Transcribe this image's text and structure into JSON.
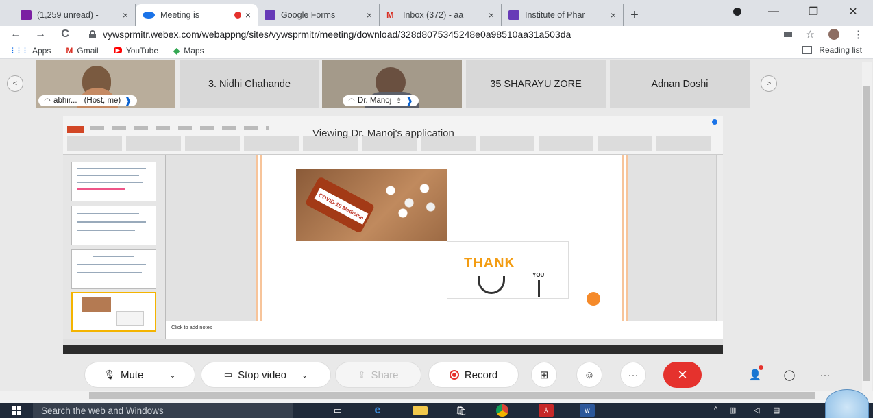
{
  "tabs": [
    {
      "label": "(1,259 unread) -",
      "fav_color": "#7b1fa2",
      "active": false
    },
    {
      "label": "Meeting is",
      "fav_color": "#1a73e8",
      "active": true,
      "recording": true
    },
    {
      "label": "Google Forms",
      "fav_color": "#673ab7",
      "active": false
    },
    {
      "label": "Inbox (372) - aa",
      "fav_color": "#d93025",
      "active": false
    },
    {
      "label": "Institute of Phar",
      "fav_color": "#673ab7",
      "active": false
    }
  ],
  "tab_close": "×",
  "new_tab": "+",
  "window": {
    "minimize": "—",
    "restore": "❐",
    "close": "✕"
  },
  "nav": {
    "back": "←",
    "forward": "→",
    "reload": "C"
  },
  "url": "vywsprmitr.webex.com/webappng/sites/vywsprmitr/meeting/download/328d8075345248e0a98510aa31a503da",
  "bookmarks": [
    {
      "label": "Apps",
      "icon": "⋮⋮⋮",
      "color": "#1a73e8"
    },
    {
      "label": "Gmail",
      "icon": "M",
      "color": "#d93025"
    },
    {
      "label": "YouTube",
      "icon": "▶",
      "color": "#ff0000"
    },
    {
      "label": "Maps",
      "icon": "◆",
      "color": "#34a853"
    }
  ],
  "reading_list": "Reading list",
  "participants": [
    {
      "label": "abhir...",
      "role": "(Host, me)",
      "video": true
    },
    {
      "label": "3. Nidhi Chahande",
      "video": false
    },
    {
      "label": "Dr. Manoj",
      "video": true
    },
    {
      "label": "35 SHARAYU ZORE",
      "video": false
    },
    {
      "label": "Adnan Doshi",
      "video": false
    }
  ],
  "share_title": "Viewing Dr. Manoj's application",
  "shared_app": {
    "notes_placeholder": "Click to add notes",
    "thank": "THANK",
    "you": "YOU",
    "bottle_text": "COVID-19 Medicine"
  },
  "controls": {
    "mute": "Mute",
    "stop_video": "Stop video",
    "share": "Share",
    "record": "Record",
    "more": "···",
    "end": "✕"
  },
  "taskbar": {
    "search_placeholder": "Search the web and Windows"
  },
  "colors": {
    "end_red": "#e5322d",
    "record_red": "#e5322d",
    "accent_orange": "#f58a2a"
  }
}
